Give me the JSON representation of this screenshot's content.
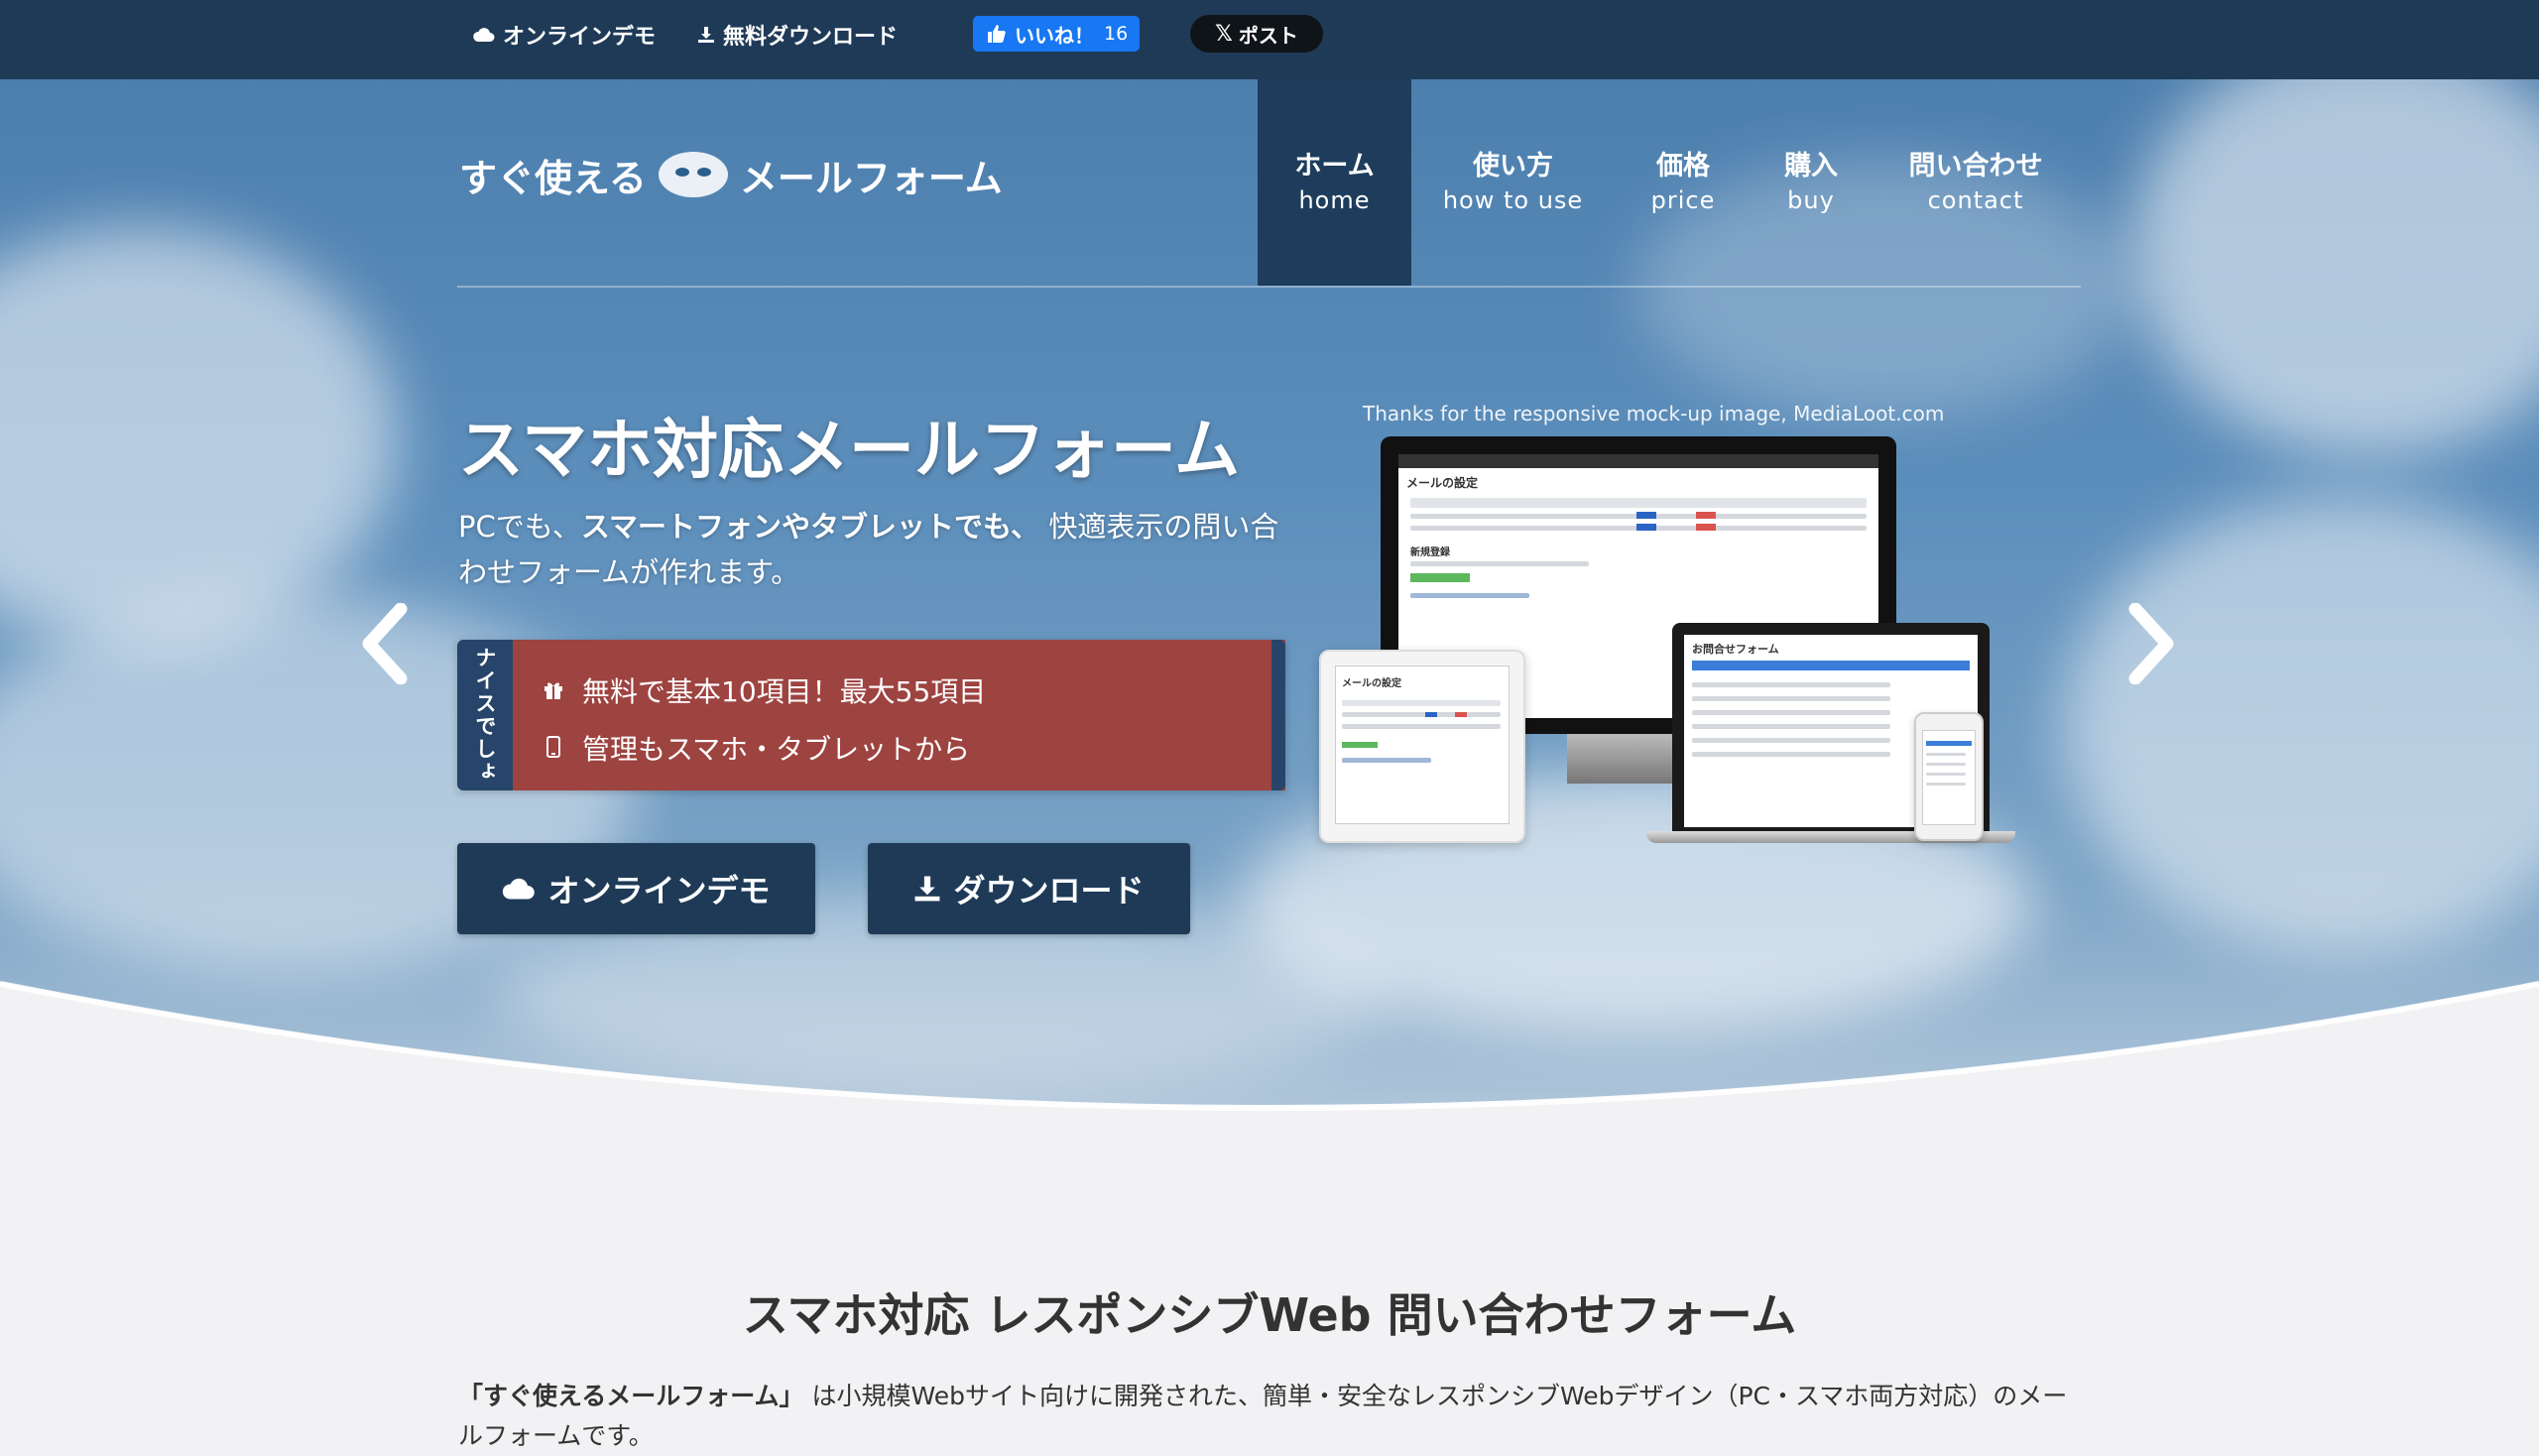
{
  "topbar": {
    "online_demo": "オンラインデモ",
    "free_download": "無料ダウンロード",
    "fb_like": "いいね！",
    "fb_count": "16",
    "x_post": "ポスト"
  },
  "logo": {
    "text_left": "すぐ使える",
    "text_right": "メールフォーム"
  },
  "nav": {
    "items": [
      {
        "jp": "ホーム",
        "en": "home"
      },
      {
        "jp": "使い方",
        "en": "how to use"
      },
      {
        "jp": "価格",
        "en": "price"
      },
      {
        "jp": "購入",
        "en": "buy"
      },
      {
        "jp": "問い合わせ",
        "en": "contact"
      }
    ]
  },
  "hero": {
    "title": "スマホ対応メールフォーム",
    "desc_1": "PCでも、",
    "desc_bold": "スマートフォンやタブレットでも、",
    "desc_2": "快適表示の問い合わせフォームが作れます。",
    "feature_tag": "ナイスでしょ",
    "features": [
      {
        "icon": "gift-icon",
        "text": "無料で基本10項目！最大55項目"
      },
      {
        "icon": "mobile-icon",
        "text": "管理もスマホ・タブレットから"
      }
    ],
    "btn_demo": "オンラインデモ",
    "btn_download": "ダウンロード",
    "credit": "Thanks for the responsive mock-up image, MediaLoot.com",
    "mock_monitor_title": "メールの設定",
    "mock_monitor_sub": "新規登録",
    "mock_tablet_title": "メールの設定",
    "mock_laptop_title": "お問合せフォーム"
  },
  "section": {
    "title": "スマホ対応 レスポンシブWeb 問い合わせフォーム",
    "text_bold": "「すぐ使えるメールフォーム」",
    "text_rest": " は小規模Webサイト向けに開発された、簡単・安全なレスポンシブWebデザイン（PC・スマホ両方対応）のメールフォームです。"
  },
  "colors": {
    "topbar": "#1f3a57",
    "nav_active": "#1e3d5c",
    "feature_bg": "#9d4340",
    "button": "#1e3a57",
    "fb": "#1877f2"
  }
}
